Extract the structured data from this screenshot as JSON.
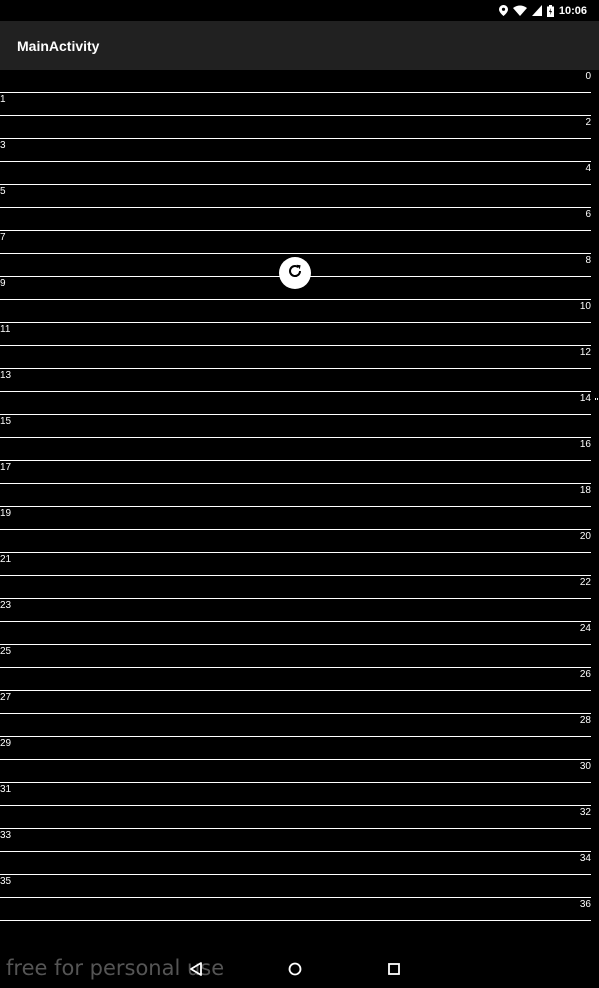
{
  "status_bar": {
    "time": "10:06",
    "icons": [
      "location-icon",
      "wifi-icon",
      "signal-icon",
      "battery-icon"
    ]
  },
  "app_bar": {
    "title": "MainActivity"
  },
  "list": {
    "items": [
      "0",
      "1",
      "2",
      "3",
      "4",
      "5",
      "6",
      "7",
      "8",
      "9",
      "10",
      "11",
      "12",
      "13",
      "14",
      "15",
      "16",
      "17",
      "18",
      "19",
      "20",
      "21",
      "22",
      "23",
      "24",
      "25",
      "26",
      "27",
      "28",
      "29",
      "30",
      "31",
      "32",
      "33",
      "34",
      "35",
      "36"
    ]
  },
  "refresh_indicator": {
    "icon": "refresh-icon"
  },
  "watermark": "free for personal use",
  "nav_bar": {
    "icons": [
      "back-icon",
      "home-icon",
      "recents-icon"
    ]
  },
  "colors": {
    "background": "#000000",
    "app_bar": "#212121",
    "text": "#ffffff",
    "divider": "#ffffff"
  }
}
